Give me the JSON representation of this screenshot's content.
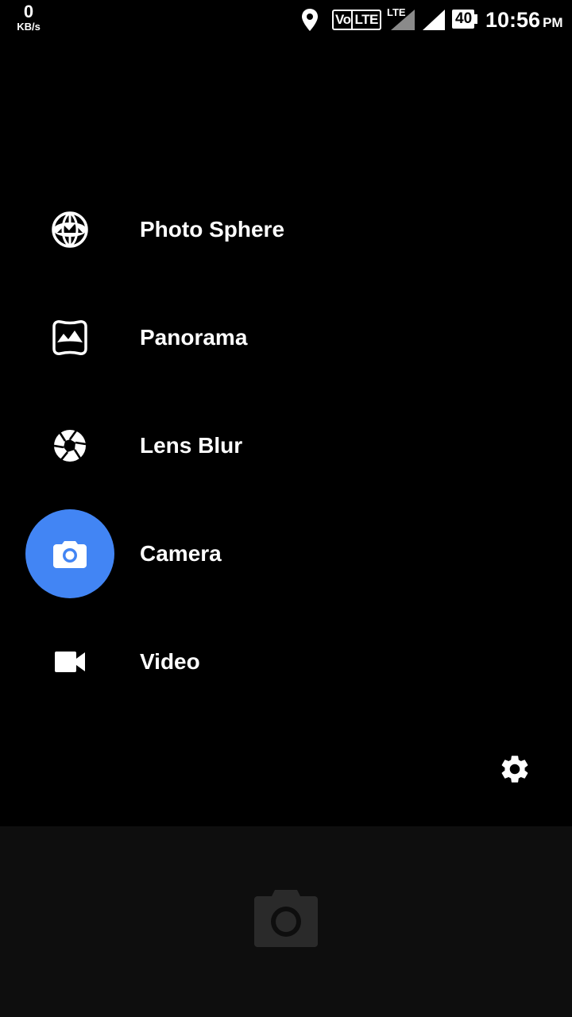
{
  "status_bar": {
    "net_speed_value": "0",
    "net_speed_unit": "KB/s",
    "volte_vo": "Vo",
    "volte_lte": "LTE",
    "lte_label": "LTE",
    "battery_level": "40",
    "time": "10:56",
    "ampm": "PM",
    "icons": [
      "location-icon",
      "volte-icon",
      "signal-icon",
      "signal-icon",
      "battery-icon"
    ]
  },
  "modes": {
    "items": [
      {
        "label": "Photo Sphere",
        "icon": "photo-sphere-icon",
        "active": false
      },
      {
        "label": "Panorama",
        "icon": "panorama-icon",
        "active": false
      },
      {
        "label": "Lens Blur",
        "icon": "lens-blur-icon",
        "active": false
      },
      {
        "label": "Camera",
        "icon": "camera-icon",
        "active": true
      },
      {
        "label": "Video",
        "icon": "video-icon",
        "active": false
      }
    ]
  },
  "settings": {
    "icon": "gear-icon"
  },
  "bottom_bar": {
    "shutter_icon": "camera-icon"
  },
  "colors": {
    "accent": "#4285f4",
    "background": "#000000",
    "bottom_bar": "#0e0e0e",
    "shutter": "#2a2a2a"
  }
}
